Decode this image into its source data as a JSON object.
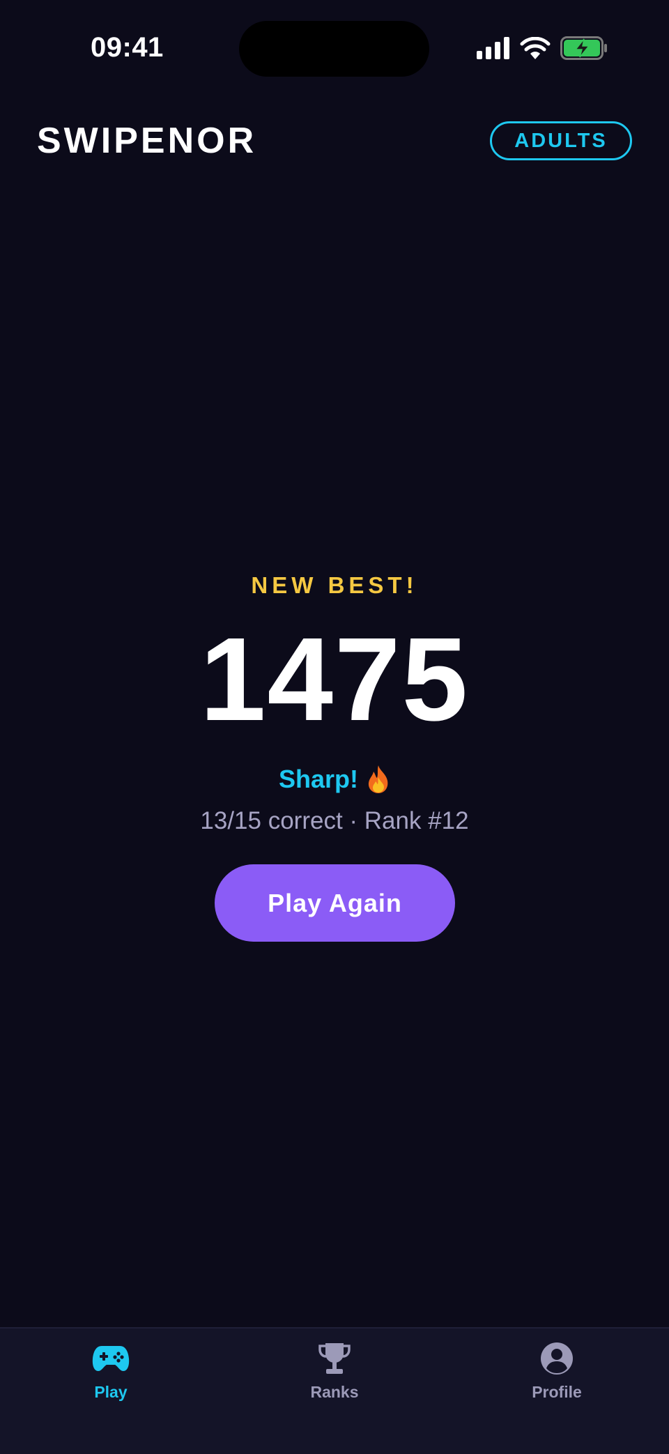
{
  "status_bar": {
    "time": "09:41",
    "icons": [
      "cellular-signal-icon",
      "wifi-icon",
      "battery-charging-icon"
    ]
  },
  "header": {
    "title": "SWIPENOR",
    "mode_label": "ADULTS"
  },
  "results": {
    "badge": "NEW BEST!",
    "score": "1475",
    "verdict": "Sharp!",
    "verdict_icon": "fire-icon",
    "summary": "13/15 correct · Rank #12",
    "play_again_label": "Play Again"
  },
  "tab_bar": {
    "active": "play",
    "tabs": [
      {
        "id": "play",
        "label": "Play",
        "icon": "gamepad-icon"
      },
      {
        "id": "ranks",
        "label": "Ranks",
        "icon": "trophy-icon"
      },
      {
        "id": "profile",
        "label": "Profile",
        "icon": "user-circle-icon"
      }
    ]
  },
  "colors": {
    "background": "#0c0b1a",
    "accent_cyan": "#1ec8f0",
    "accent_yellow": "#f5c842",
    "button_purple": "#8b5cf6",
    "muted_text": "#a7a4c4",
    "tab_bar_bg": "#141428"
  }
}
